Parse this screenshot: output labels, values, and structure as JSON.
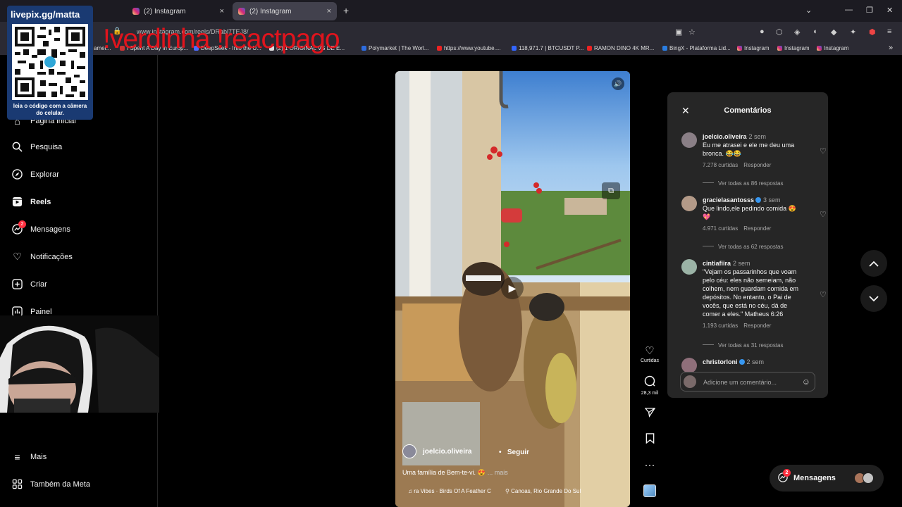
{
  "browser": {
    "tabs": [
      {
        "label": "(2) Instagram",
        "close": "×"
      },
      {
        "label": "(2) Instagram",
        "close": "×"
      }
    ],
    "new_tab": "+",
    "url": "www.instagram.com/reels/DRabl7TEJ8/",
    "bookmarks": [
      "amer...",
      "I Spent A Day in Europ...",
      "DeepSeek - Into the U...",
      "(2) 1 ORIGINAL VS DE E...",
      "Polymarket | The Worl...",
      "https://www.youtube....",
      "118,971.7 | BTCUSDT P...",
      "RAMON DINO 4K MR...",
      "BingX - Plataforma Lid...",
      "Instagram",
      "Instagram",
      "Instagram"
    ]
  },
  "overlay": {
    "qr_title": "livepix.gg/matta",
    "qr_caption": "leia o código com a câmera do celular.",
    "red_text": "!verdinha !reactpago"
  },
  "sidebar": {
    "items": [
      {
        "label": "Página inicial",
        "icon": "home-icon"
      },
      {
        "label": "Pesquisa",
        "icon": "search-icon"
      },
      {
        "label": "Explorar",
        "icon": "compass-icon"
      },
      {
        "label": "Reels",
        "icon": "reels-icon"
      },
      {
        "label": "Mensagens",
        "icon": "messenger-icon",
        "badge": "2"
      },
      {
        "label": "Notificações",
        "icon": "heart-icon"
      },
      {
        "label": "Criar",
        "icon": "plus-square-icon"
      },
      {
        "label": "Painel",
        "icon": "dashboard-icon"
      },
      {
        "label": "Mais",
        "icon": "menu-icon"
      },
      {
        "label": "Também da Meta",
        "icon": "meta-grid-icon"
      }
    ]
  },
  "reel": {
    "author": "joelcio.oliveira",
    "follow": "Seguir",
    "separator": "•",
    "caption": "Uma família de Bem-te-vi. 😍",
    "more": "... mais",
    "audio": "ra Vibes · Birds Of A Feather  C",
    "location": "Canoas, Rio Grande Do Sul"
  },
  "actions": {
    "likes_label": "Curtidas",
    "comments_count": "28,3 mil"
  },
  "comments_panel": {
    "title": "Comentários",
    "input_placeholder": "Adicione um comentário...",
    "comments": [
      {
        "user": "joelcio.oliveira",
        "time": "2 sem",
        "text": "Eu me atrasei e ele me deu uma bronca. 😂😂",
        "likes": "7.278 curtidas",
        "reply": "Responder",
        "replies": "Ver todas as 86 respostas",
        "avatar_color": "#8a7f86"
      },
      {
        "user": "gracielasantosss",
        "time": "3 sem",
        "text": "Que lindo,ele pedindo comida 😍💖",
        "likes": "4.971 curtidas",
        "reply": "Responder",
        "replies": "Ver todas as 62 respostas",
        "avatar_color": "#b39a88"
      },
      {
        "user": "cintiafiira",
        "time": "2 sem",
        "text": "\"Vejam os passarinhos que voam pelo céu: eles não semeiam, não colhem, nem guardam comida em depósitos. No entanto, o Pai de vocês, que está no céu, dá de comer a eles.\" Matheus 6:26",
        "likes": "1.193 curtidas",
        "reply": "Responder",
        "replies": "Ver todas as 31 respostas",
        "avatar_color": "#9bb3a6"
      },
      {
        "user": "christorloni",
        "time": "2 sem",
        "avatar_color": "#8f6f7a"
      }
    ]
  },
  "messages_float": {
    "label": "Mensagens",
    "badge": "2"
  }
}
